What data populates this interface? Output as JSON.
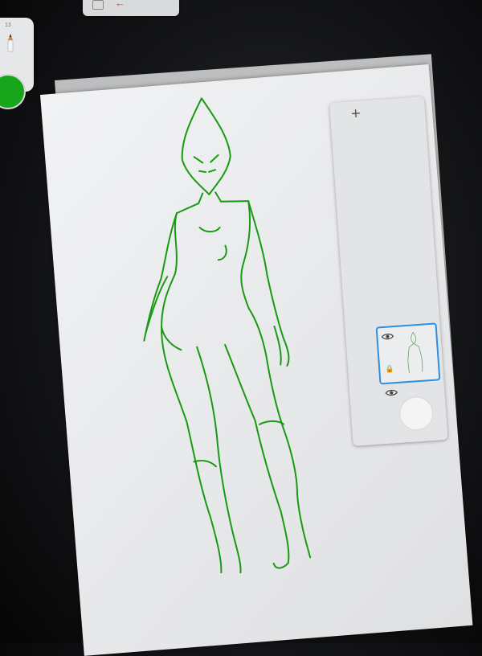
{
  "toolbar": {
    "icons": [
      "menu-icon",
      "undo-icon"
    ]
  },
  "brush_panel": {
    "size_value": "13",
    "tool_icon": "pencil-icon",
    "color": "#17a51b"
  },
  "canvas": {
    "stroke_color": "#1a9a12",
    "background": "#eeeff1"
  },
  "layers_panel": {
    "add_label": "+",
    "layers": [
      {
        "visible": true,
        "selected": true,
        "thumbnail": "figure-sketch"
      },
      {
        "visible": true,
        "selected": false,
        "thumbnail": "empty"
      }
    ]
  }
}
